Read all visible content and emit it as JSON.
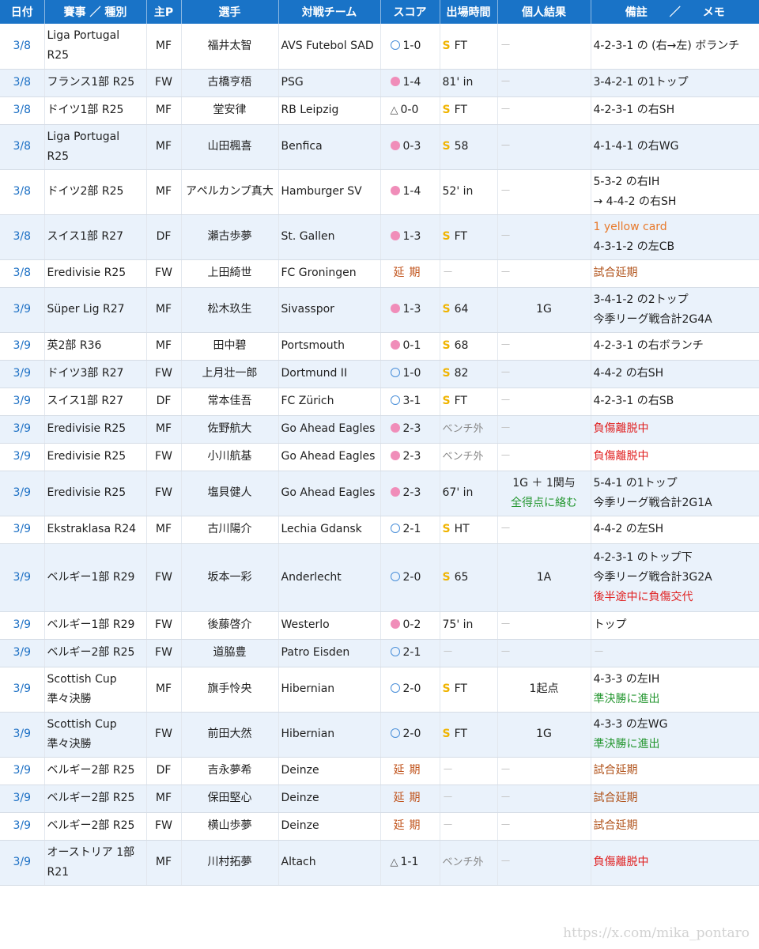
{
  "headers": {
    "date": "日付",
    "competition": "賽事 ／ 種別",
    "position": "主P",
    "player": "選手",
    "opponent": "対戦チーム",
    "score": "スコア",
    "minutes": "出場時間",
    "result": "個人結果",
    "note": "備註　　／　　メモ"
  },
  "rows": [
    {
      "date": "3/8",
      "comp": [
        "Liga Portugal",
        "R25"
      ],
      "pos": "MF",
      "player": "福井太智",
      "opp": "AVS Futebol SAD",
      "score_icon": "win",
      "score": "1-0",
      "min_icon": "start",
      "min": "FT",
      "result": [
        {
          "t": "－",
          "c": "dash"
        }
      ],
      "note": [
        {
          "t": "4-2-3-1 の (右→左) ボランチ",
          "c": ""
        }
      ]
    },
    {
      "date": "3/8",
      "comp": [
        "フランス1部  R25"
      ],
      "pos": "FW",
      "player": "古橋亨梧",
      "opp": "PSG",
      "score_icon": "loss",
      "score": "1-4",
      "min_icon": "",
      "min": "81' in",
      "result": [
        {
          "t": "－",
          "c": "dash"
        }
      ],
      "note": [
        {
          "t": "3-4-2-1 の1トップ",
          "c": ""
        }
      ]
    },
    {
      "date": "3/8",
      "comp": [
        "ドイツ1部  R25"
      ],
      "pos": "MF",
      "player": "堂安律",
      "opp": "RB Leipzig",
      "score_icon": "draw",
      "score": "0-0",
      "min_icon": "start",
      "min": "FT",
      "result": [
        {
          "t": "－",
          "c": "dash"
        }
      ],
      "note": [
        {
          "t": "4-2-3-1 の右SH",
          "c": ""
        }
      ]
    },
    {
      "date": "3/8",
      "comp": [
        "Liga Portugal",
        "R25"
      ],
      "pos": "MF",
      "player": "山田楓喜",
      "opp": "Benfica",
      "score_icon": "loss",
      "score": "0-3",
      "min_icon": "start",
      "min": "58",
      "result": [
        {
          "t": "－",
          "c": "dash"
        }
      ],
      "note": [
        {
          "t": "4-1-4-1 の右WG",
          "c": ""
        }
      ]
    },
    {
      "date": "3/8",
      "comp": [
        "ドイツ2部  R25"
      ],
      "pos": "MF",
      "player": "アペルカンプ真大",
      "opp": "Hamburger SV",
      "score_icon": "loss",
      "score": "1-4",
      "min_icon": "",
      "min": "52' in",
      "result": [
        {
          "t": "－",
          "c": "dash"
        }
      ],
      "note": [
        {
          "t": "5-3-2 の右IH",
          "c": ""
        },
        {
          "t": "→ 4-4-2 の右SH",
          "c": ""
        }
      ]
    },
    {
      "date": "3/8",
      "comp": [
        "スイス1部  R27"
      ],
      "pos": "DF",
      "player": "瀬古歩夢",
      "opp": "St. Gallen",
      "score_icon": "loss",
      "score": "1-3",
      "min_icon": "start",
      "min": "FT",
      "result": [
        {
          "t": "－",
          "c": "dash"
        }
      ],
      "note": [
        {
          "t": "1 yellow card",
          "c": "orange"
        },
        {
          "t": "4-3-1-2 の左CB",
          "c": ""
        }
      ]
    },
    {
      "date": "3/8",
      "comp": [
        "Eredivisie   R25"
      ],
      "pos": "FW",
      "player": "上田綺世",
      "opp": "FC Groningen",
      "score_icon": "postponed",
      "score": "延期",
      "min_icon": "",
      "min": "－",
      "result": [
        {
          "t": "－",
          "c": "dash"
        }
      ],
      "note": [
        {
          "t": "試合延期",
          "c": "brown"
        }
      ]
    },
    {
      "date": "3/9",
      "comp": [
        "Süper Lig  R27"
      ],
      "pos": "MF",
      "player": "松木玖生",
      "opp": "Sivasspor",
      "score_icon": "loss",
      "score": "1-3",
      "min_icon": "start",
      "min": "64",
      "result": [
        {
          "t": "1G",
          "c": ""
        }
      ],
      "note": [
        {
          "t": "3-4-1-2 の2トップ",
          "c": ""
        },
        {
          "t": "今季リーグ戦合計2G4A",
          "c": ""
        }
      ]
    },
    {
      "date": "3/9",
      "comp": [
        "英2部  R36"
      ],
      "pos": "MF",
      "player": "田中碧",
      "opp": "Portsmouth",
      "score_icon": "loss",
      "score": "0-1",
      "min_icon": "start",
      "min": "68",
      "result": [
        {
          "t": "－",
          "c": "dash"
        }
      ],
      "note": [
        {
          "t": "4-2-3-1 の右ボランチ",
          "c": ""
        }
      ]
    },
    {
      "date": "3/9",
      "comp": [
        "ドイツ3部  R27"
      ],
      "pos": "FW",
      "player": "上月壮一郎",
      "opp": "Dortmund II",
      "score_icon": "win",
      "score": "1-0",
      "min_icon": "start",
      "min": "82",
      "result": [
        {
          "t": "－",
          "c": "dash"
        }
      ],
      "note": [
        {
          "t": "4-4-2 の右SH",
          "c": ""
        }
      ]
    },
    {
      "date": "3/9",
      "comp": [
        "スイス1部  R27"
      ],
      "pos": "DF",
      "player": "常本佳吾",
      "opp": "FC Zürich",
      "score_icon": "win",
      "score": "3-1",
      "min_icon": "start",
      "min": "FT",
      "result": [
        {
          "t": "－",
          "c": "dash"
        }
      ],
      "note": [
        {
          "t": "4-2-3-1 の右SB",
          "c": ""
        }
      ]
    },
    {
      "date": "3/9",
      "comp": [
        "Eredivisie   R25"
      ],
      "pos": "MF",
      "player": "佐野航大",
      "opp": "Go Ahead Eagles",
      "score_icon": "loss",
      "score": "2-3",
      "min_icon": "bench",
      "min": "ベンチ外",
      "result": [
        {
          "t": "－",
          "c": "dash"
        }
      ],
      "note": [
        {
          "t": "負傷離脱中",
          "c": "red"
        }
      ]
    },
    {
      "date": "3/9",
      "comp": [
        "Eredivisie   R25"
      ],
      "pos": "FW",
      "player": "小川航基",
      "opp": "Go Ahead Eagles",
      "score_icon": "loss",
      "score": "2-3",
      "min_icon": "bench",
      "min": "ベンチ外",
      "result": [
        {
          "t": "－",
          "c": "dash"
        }
      ],
      "note": [
        {
          "t": "負傷離脱中",
          "c": "red"
        }
      ]
    },
    {
      "date": "3/9",
      "comp": [
        "Eredivisie   R25"
      ],
      "pos": "FW",
      "player": "塩貝健人",
      "opp": "Go Ahead Eagles",
      "score_icon": "loss",
      "score": "2-3",
      "min_icon": "",
      "min": "67' in",
      "result": [
        {
          "t": "1G ＋ 1関与",
          "c": ""
        },
        {
          "t": "全得点に絡む",
          "c": "green"
        }
      ],
      "note": [
        {
          "t": "5-4-1 の1トップ",
          "c": ""
        },
        {
          "t": "今季リーグ戦合計2G1A",
          "c": ""
        }
      ]
    },
    {
      "date": "3/9",
      "comp": [
        "Ekstraklasa  R24"
      ],
      "pos": "MF",
      "player": "古川陽介",
      "opp": "Lechia Gdansk",
      "score_icon": "win",
      "score": "2-1",
      "min_icon": "start",
      "min": "HT",
      "result": [
        {
          "t": "－",
          "c": "dash"
        }
      ],
      "note": [
        {
          "t": "4-4-2 の左SH",
          "c": ""
        }
      ]
    },
    {
      "date": "3/9",
      "comp": [
        "ベルギー1部  R29"
      ],
      "pos": "FW",
      "player": "坂本一彩",
      "opp": "Anderlecht",
      "score_icon": "win",
      "score": "2-0",
      "min_icon": "start",
      "min": "65",
      "result": [
        {
          "t": "1A",
          "c": ""
        }
      ],
      "note": [
        {
          "t": "4-2-3-1 のトップ下",
          "c": ""
        },
        {
          "t": "今季リーグ戦合計3G2A",
          "c": ""
        },
        {
          "t": "後半途中に負傷交代",
          "c": "red"
        }
      ]
    },
    {
      "date": "3/9",
      "comp": [
        "ベルギー1部  R29"
      ],
      "pos": "FW",
      "player": "後藤啓介",
      "opp": "Westerlo",
      "score_icon": "loss",
      "score": "0-2",
      "min_icon": "",
      "min": "75' in",
      "result": [
        {
          "t": "－",
          "c": "dash"
        }
      ],
      "note": [
        {
          "t": "トップ",
          "c": ""
        }
      ]
    },
    {
      "date": "3/9",
      "comp": [
        "ベルギー2部  R25"
      ],
      "pos": "FW",
      "player": "道脇豊",
      "opp": "Patro Eisden",
      "score_icon": "win",
      "score": "2-1",
      "min_icon": "",
      "min": "－",
      "result": [
        {
          "t": "－",
          "c": "dash"
        }
      ],
      "note": [
        {
          "t": "－",
          "c": "dash"
        }
      ]
    },
    {
      "date": "3/9",
      "comp": [
        "Scottish Cup",
        "準々決勝"
      ],
      "pos": "MF",
      "player": "旗手怜央",
      "opp": "Hibernian",
      "score_icon": "win",
      "score": "2-0",
      "min_icon": "start",
      "min": "FT",
      "result": [
        {
          "t": "1起点",
          "c": ""
        }
      ],
      "note": [
        {
          "t": "4-3-3 の左IH",
          "c": ""
        },
        {
          "t": "準決勝に進出",
          "c": "green"
        }
      ]
    },
    {
      "date": "3/9",
      "comp": [
        "Scottish Cup",
        "準々決勝"
      ],
      "pos": "FW",
      "player": "前田大然",
      "opp": "Hibernian",
      "score_icon": "win",
      "score": "2-0",
      "min_icon": "start",
      "min": "FT",
      "result": [
        {
          "t": "1G",
          "c": ""
        }
      ],
      "note": [
        {
          "t": "4-3-3 の左WG",
          "c": ""
        },
        {
          "t": "準決勝に進出",
          "c": "green"
        }
      ]
    },
    {
      "date": "3/9",
      "comp": [
        "ベルギー2部  R25"
      ],
      "pos": "DF",
      "player": "吉永夢希",
      "opp": "Deinze",
      "score_icon": "postponed",
      "score": "延期",
      "min_icon": "",
      "min": "－",
      "result": [
        {
          "t": "－",
          "c": "dash"
        }
      ],
      "note": [
        {
          "t": "試合延期",
          "c": "brown"
        }
      ]
    },
    {
      "date": "3/9",
      "comp": [
        "ベルギー2部  R25"
      ],
      "pos": "MF",
      "player": "保田堅心",
      "opp": "Deinze",
      "score_icon": "postponed",
      "score": "延期",
      "min_icon": "",
      "min": "－",
      "result": [
        {
          "t": "－",
          "c": "dash"
        }
      ],
      "note": [
        {
          "t": "試合延期",
          "c": "brown"
        }
      ]
    },
    {
      "date": "3/9",
      "comp": [
        "ベルギー2部  R25"
      ],
      "pos": "FW",
      "player": "横山歩夢",
      "opp": "Deinze",
      "score_icon": "postponed",
      "score": "延期",
      "min_icon": "",
      "min": "－",
      "result": [
        {
          "t": "－",
          "c": "dash"
        }
      ],
      "note": [
        {
          "t": "試合延期",
          "c": "brown"
        }
      ]
    },
    {
      "date": "3/9",
      "comp": [
        "オーストリア 1部",
        "R21"
      ],
      "pos": "MF",
      "player": "川村拓夢",
      "opp": "Altach",
      "score_icon": "draw",
      "score": "1-1",
      "min_icon": "bench",
      "min": "ベンチ外",
      "result": [
        {
          "t": "－",
          "c": "dash"
        }
      ],
      "note": [
        {
          "t": "負傷離脱中",
          "c": "red"
        }
      ]
    }
  ],
  "icons": {
    "win": "circle-outline-icon",
    "loss": "pink-dot-icon",
    "draw": "triangle-icon",
    "start": "starter-s-icon"
  },
  "watermark": "https://x.com/mika_pontaro",
  "colors": {
    "header_bg": "#1973c7",
    "row_alt": "#eaf2fb",
    "date_text": "#1b6fc4",
    "win_ring": "#4a8fd9",
    "loss_dot": "#f08db9",
    "starter": "#f0b400",
    "orange": "#e8792a",
    "red": "#e02020",
    "green": "#23962f",
    "brown": "#b0521a"
  }
}
